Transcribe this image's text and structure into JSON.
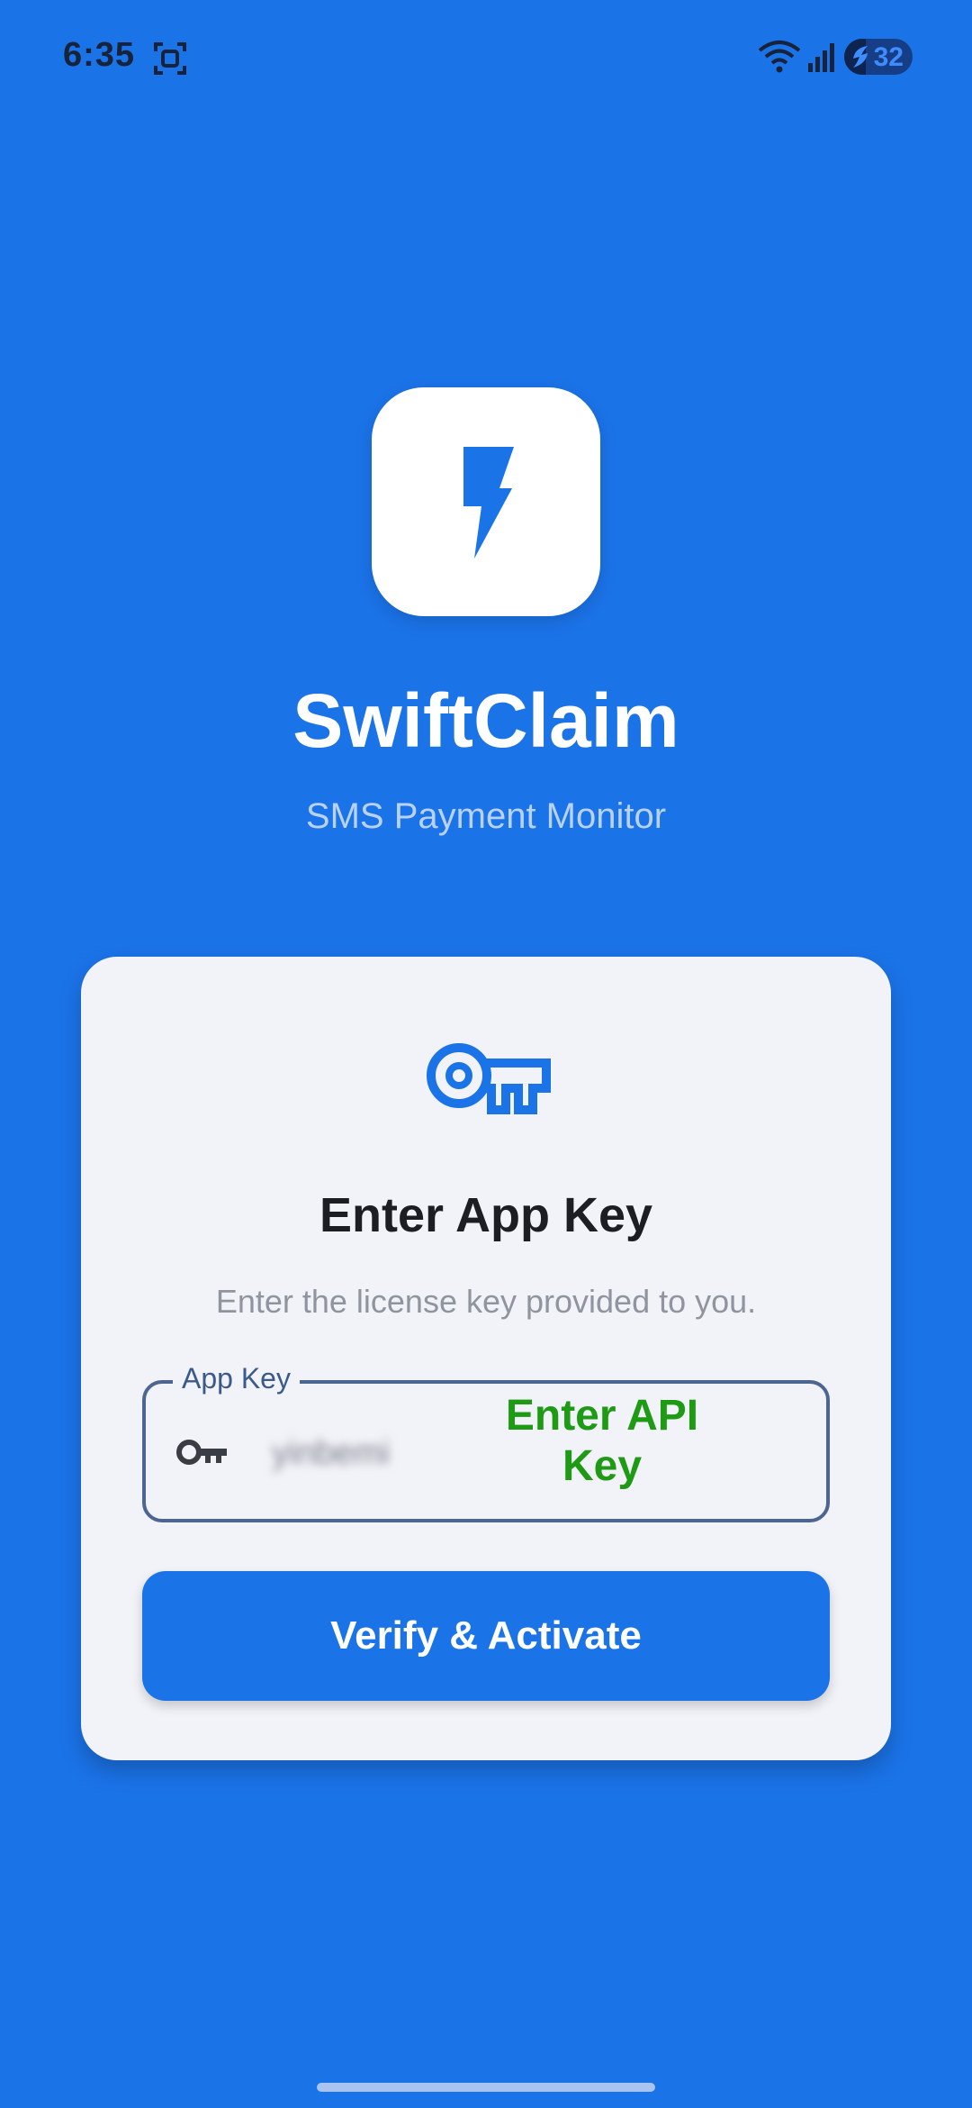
{
  "status_bar": {
    "time": "6:35",
    "battery_level": "32",
    "battery_fraction": 0.32,
    "icons": [
      "screenshot-icon",
      "wifi-icon",
      "signal-icon",
      "battery-icon"
    ]
  },
  "header": {
    "app_name": "SwiftClaim",
    "tagline": "SMS Payment Monitor",
    "logo_icon": "lightning-bolt-icon"
  },
  "card": {
    "icon": "key-icon",
    "title": "Enter App Key",
    "subtitle": "Enter the license key provided to you.",
    "field": {
      "label": "App Key",
      "value": "yinbemi",
      "hint_overlay": "Enter API Key",
      "icon": "key-icon"
    },
    "button_label": "Verify & Activate"
  },
  "colors": {
    "primary": "#1b73e8",
    "card_background": "#f1f3f8",
    "hint_text": "#1f9a14",
    "field_border": "#4d6690"
  }
}
